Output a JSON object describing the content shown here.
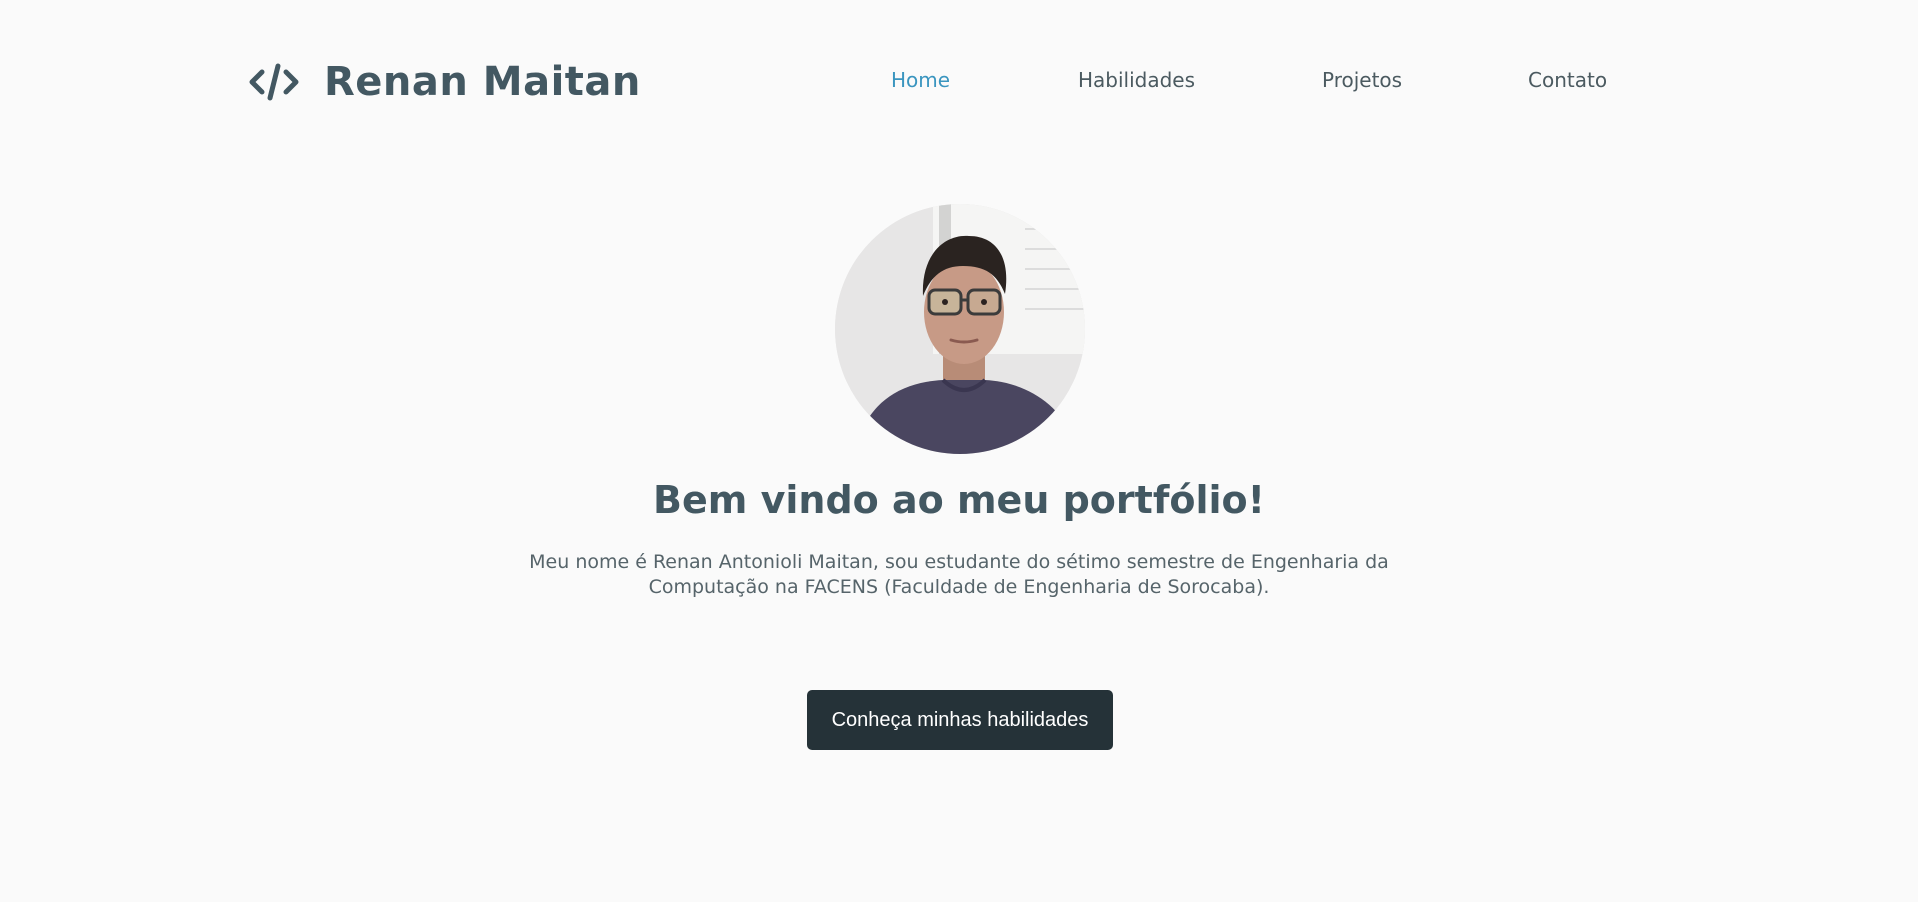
{
  "header": {
    "brand_name": "Renan Maitan",
    "brand_icon": "code-icon"
  },
  "nav": {
    "items": [
      {
        "label": "Home",
        "active": true
      },
      {
        "label": "Habilidades",
        "active": false
      },
      {
        "label": "Projetos",
        "active": false
      },
      {
        "label": "Contato",
        "active": false
      }
    ]
  },
  "hero": {
    "avatar": "profile-photo",
    "title": "Bem vindo ao meu portfólio!",
    "description": "Meu nome é Renan Antonioli Maitan, sou estudante do sétimo semestre de Engenharia da Computação na FACENS (Faculdade de Engenharia de Sorocaba).",
    "cta_label": "Conheça minhas habilidades"
  },
  "colors": {
    "background": "#fafafa",
    "heading": "#435862",
    "nav_active": "#3a95bf",
    "nav_text": "#4b5a60",
    "button_bg": "#253238",
    "button_text": "#ffffff"
  }
}
